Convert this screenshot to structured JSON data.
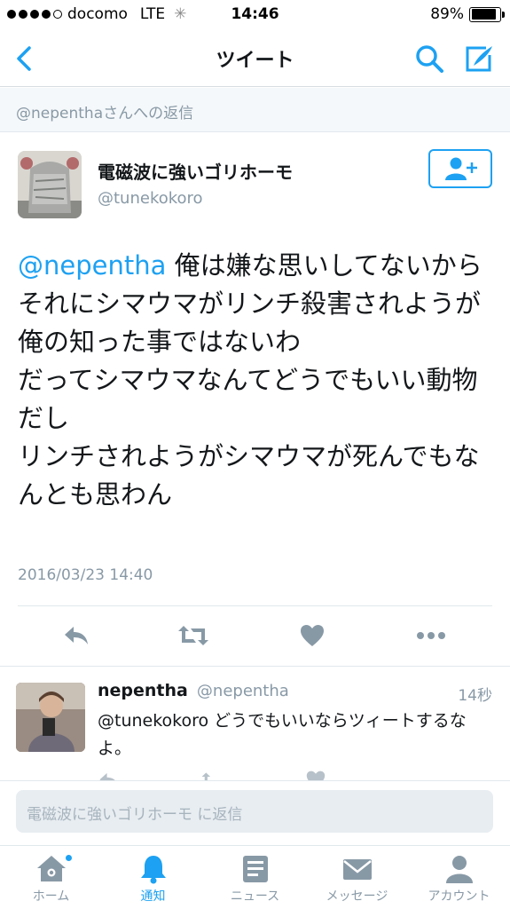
{
  "status": {
    "carrier": "docomo",
    "network": "LTE",
    "time": "14:46",
    "battery_text": "89%",
    "battery_level": 0.89,
    "signal_bars": 4
  },
  "nav": {
    "title": "ツイート"
  },
  "reply_context": "@nepenthaさんへの返信",
  "tweet": {
    "author_name": "電磁波に強いゴリホーモ",
    "author_handle": "@tunekokoro",
    "mention": "@nepentha",
    "lines": [
      " 俺は嫌な思いしてないから",
      "それにシマウマがリンチ殺害されようが俺の知った事ではないわ",
      "だってシマウマなんてどうでもいい動物だし",
      "リンチされようがシマウマが死んでもなんとも思わん"
    ],
    "timestamp": "2016/03/23 14:40"
  },
  "reply": {
    "author_name": "nepentha",
    "author_handle": "@nepentha",
    "time_ago": "14秒",
    "text": "@tunekokoro どうでもいいならツィートするなよ。"
  },
  "composer": {
    "placeholder": "電磁波に強いゴリホーモ に返信"
  },
  "tabs": [
    {
      "label": "ホーム",
      "icon": "home-icon",
      "active": false,
      "has_badge": true
    },
    {
      "label": "通知",
      "icon": "bell-icon",
      "active": true,
      "has_badge": false
    },
    {
      "label": "ニュース",
      "icon": "news-icon",
      "active": false,
      "has_badge": false
    },
    {
      "label": "メッセージ",
      "icon": "envelope-icon",
      "active": false,
      "has_badge": false
    },
    {
      "label": "アカウント",
      "icon": "person-icon",
      "active": false,
      "has_badge": false
    }
  ],
  "colors": {
    "accent": "#1da1f2",
    "muted": "#8899a6",
    "icon_gray": "#8899a6"
  }
}
